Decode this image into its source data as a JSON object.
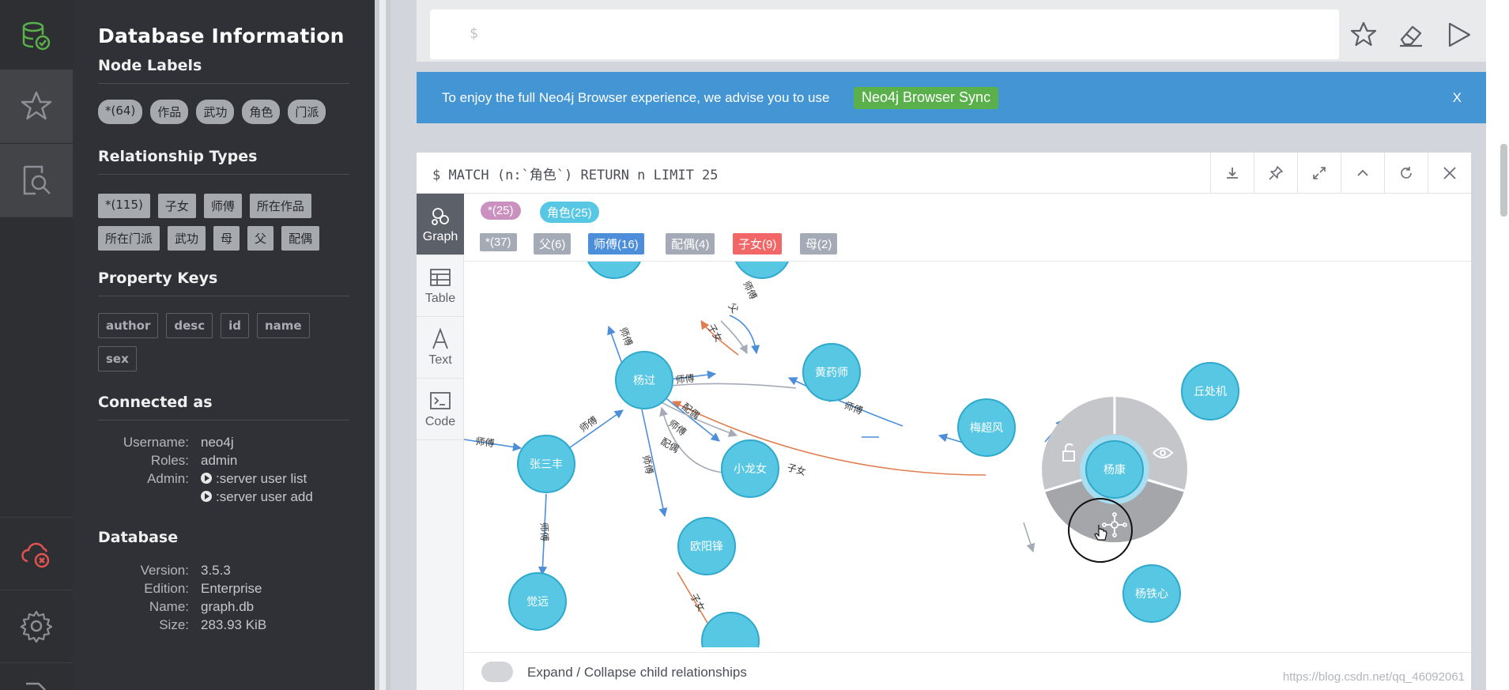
{
  "rail": {
    "icons": [
      "database-check-icon",
      "star-icon",
      "search-doc-icon",
      "cloud-error-icon",
      "gear-icon"
    ]
  },
  "drawer": {
    "title": "Database Information",
    "node_labels_title": "Node Labels",
    "node_labels": [
      "*(64)",
      "作品",
      "武功",
      "角色",
      "门派"
    ],
    "rel_types_title": "Relationship Types",
    "rel_types": [
      "*(115)",
      "子女",
      "师傅",
      "所在作品",
      "所在门派",
      "武功",
      "母",
      "父",
      "配偶"
    ],
    "property_keys_title": "Property Keys",
    "property_keys": [
      "author",
      "desc",
      "id",
      "name",
      "sex"
    ],
    "connected_title": "Connected as",
    "username_label": "Username:",
    "username": "neo4j",
    "roles_label": "Roles:",
    "roles": "admin",
    "admin_label": "Admin:",
    "admin_cmd1": ":server user list",
    "admin_cmd2": ":server user add",
    "database_title": "Database",
    "version_label": "Version:",
    "version": "3.5.3",
    "edition_label": "Edition:",
    "edition": "Enterprise",
    "name_label": "Name:",
    "name": "graph.db",
    "size_label": "Size:",
    "size": "283.93 KiB"
  },
  "editor": {
    "prompt": "$"
  },
  "banner": {
    "text": "To enjoy the full Neo4j Browser experience, we advise you to use",
    "button": "Neo4j Browser Sync",
    "close": "X"
  },
  "frame": {
    "query": "$ MATCH (n:`角色`) RETURN n LIMIT 25",
    "tabs": [
      "Graph",
      "Table",
      "Text",
      "Code"
    ],
    "label_chips": [
      {
        "text": "*(25)",
        "color": "#c990c0"
      },
      {
        "text": "角色(25)",
        "color": "#57c7e3"
      }
    ],
    "rel_chips": [
      {
        "text": "*(37)",
        "color": "#a5abb6"
      },
      {
        "text": "父(6)",
        "color": "#a5abb6"
      },
      {
        "text": "师傅(16)",
        "color": "#4c8eda"
      },
      {
        "text": "配偶(4)",
        "color": "#a5abb6"
      },
      {
        "text": "子女(9)",
        "color": "#f16667"
      },
      {
        "text": "母(2)",
        "color": "#a5abb6"
      }
    ],
    "footer_text": "Expand / Collapse child relationships",
    "watermark": "https://blog.csdn.net/qq_46092061"
  },
  "graph": {
    "nodes": {
      "yangguo": "杨过",
      "huangyaoshi": "黄药师",
      "zhangsanfeng": "张三丰",
      "xiaolongnv": "小龙女",
      "ouyangfeng": "欧阳锋",
      "jueyuan": "觉远",
      "meichaofeng": "梅超风",
      "qiuchuji": "丘处机",
      "yangkang": "杨康",
      "yangtiexin": "杨铁心"
    },
    "edge_labels": {
      "shifu": "师傅",
      "peiou": "配偶",
      "zinv": "子女",
      "fu": "父"
    }
  }
}
